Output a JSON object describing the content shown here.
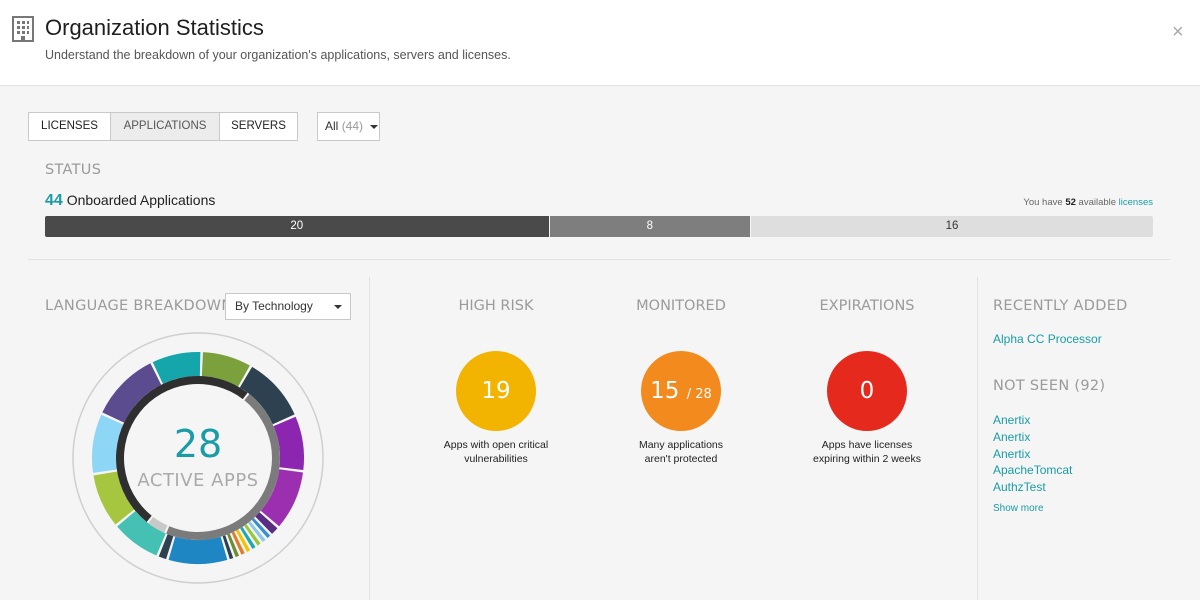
{
  "header": {
    "title": "Organization Statistics",
    "subtitle": "Understand the breakdown of your organization's applications, servers and licenses.",
    "close_glyph": "×"
  },
  "tabs": [
    {
      "label": "LICENSES",
      "active": false
    },
    {
      "label": "APPLICATIONS",
      "active": true
    },
    {
      "label": "SERVERS",
      "active": false
    }
  ],
  "filter": {
    "label": "All",
    "count": "(44)"
  },
  "status": {
    "label": "STATUS",
    "onboarded_count": "44",
    "onboarded_label": "Onboarded Applications",
    "available_prefix": "You have",
    "available_count": "52",
    "available_middle": "available",
    "available_link": "licenses",
    "segments": [
      {
        "value": 20,
        "label": "20",
        "color": "#4a4a4a",
        "text_color": "#ffffff"
      },
      {
        "value": 8,
        "label": "8",
        "color": "#7e7e7e",
        "text_color": "#ffffff"
      },
      {
        "value": 16,
        "label": "16",
        "color": "#dedede",
        "text_color": "#333333"
      }
    ]
  },
  "language": {
    "label": "LANGUAGE BREAKDOWN",
    "group_by": "By Technology",
    "active_count": "28",
    "active_label": "ACTIVE APPS",
    "outer_segments": [
      {
        "value": 10,
        "color": "#15a6ac"
      },
      {
        "value": 10,
        "color": "#7ba13d"
      },
      {
        "value": 13,
        "color": "#2d4150"
      },
      {
        "value": 11,
        "color": "#8c26b0"
      },
      {
        "value": 12,
        "color": "#9c2fb0"
      },
      {
        "value": 2,
        "color": "#5b2c84"
      },
      {
        "value": 1.2,
        "color": "#3a8fd0"
      },
      {
        "value": 1.2,
        "color": "#8ec8e8"
      },
      {
        "value": 1.2,
        "color": "#9bc53d"
      },
      {
        "value": 1.2,
        "color": "#1fa7b3"
      },
      {
        "value": 1.2,
        "color": "#f0c400"
      },
      {
        "value": 1.2,
        "color": "#e07a2e"
      },
      {
        "value": 1.2,
        "color": "#6a8f2f"
      },
      {
        "value": 1.2,
        "color": "#2d4150"
      },
      {
        "value": 12,
        "color": "#1e86c2"
      },
      {
        "value": 2,
        "color": "#2d4150"
      },
      {
        "value": 10,
        "color": "#44c1b2"
      },
      {
        "value": 11,
        "color": "#a6c640"
      },
      {
        "value": 12,
        "color": "#8ed6f5"
      },
      {
        "value": 14,
        "color": "#5b4c8f"
      }
    ],
    "inner_segments": [
      {
        "value": 46,
        "color": "#7b7b7b"
      },
      {
        "value": 4,
        "color": "#c9c9c9"
      },
      {
        "value": 50,
        "color": "#2f2f2f"
      }
    ]
  },
  "stats": [
    {
      "title": "HIGH RISK",
      "value": "19",
      "denominator": "",
      "color": "#f2b400",
      "desc_line1": "Apps with open critical",
      "desc_line2": "vulnerabilities"
    },
    {
      "title": "MONITORED",
      "value": "15",
      "denominator": "/ 28",
      "color": "#f28a1e",
      "desc_line1": "Many applications",
      "desc_line2": "aren't protected"
    },
    {
      "title": "EXPIRATIONS",
      "value": "0",
      "denominator": "",
      "color": "#e5291c",
      "desc_line1": "Apps have licenses",
      "desc_line2": "expiring within 2 weeks"
    }
  ],
  "recently_added": {
    "label": "RECENTLY ADDED",
    "items": [
      "Alpha CC Processor"
    ]
  },
  "not_seen": {
    "label": "NOT SEEN (92)",
    "items": [
      "Anertix",
      "Anertix",
      "Anertix",
      "ApacheTomcat",
      "AuthzTest"
    ],
    "show_more": "Show more"
  },
  "icons": {
    "header": "building-icon",
    "close": "close-icon",
    "dropdown": "caret-down-icon"
  },
  "colors": {
    "accent": "#1a9ca7",
    "muted_label": "#9a9a9a"
  }
}
